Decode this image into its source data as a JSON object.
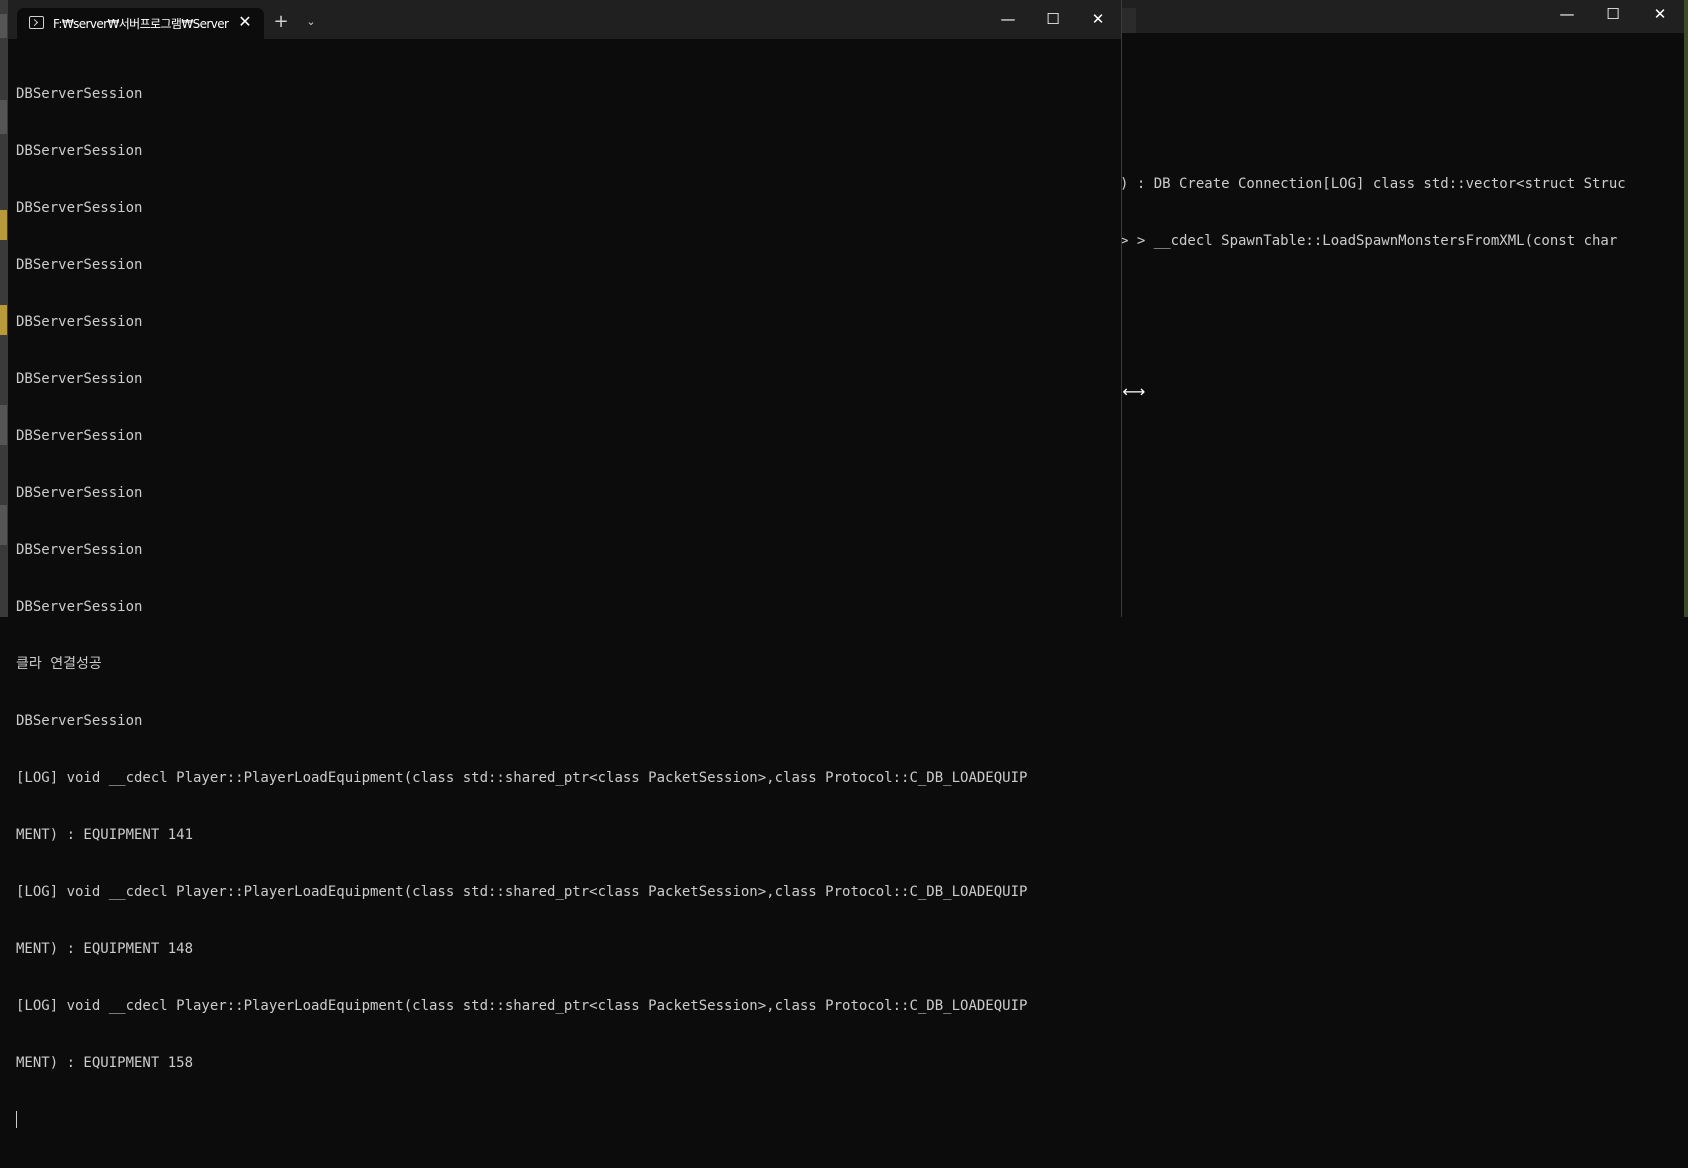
{
  "foreground_window": {
    "tab_title": "F:₩server₩서버프로그램₩Server",
    "tab_close": "✕",
    "new_tab": "+",
    "dropdown": "⌄",
    "controls": {
      "minimize": "—",
      "maximize": "☐",
      "close": "✕"
    },
    "lines": [
      "DBServerSession",
      "DBServerSession",
      "DBServerSession",
      "DBServerSession",
      "DBServerSession",
      "DBServerSession",
      "DBServerSession",
      "DBServerSession",
      "DBServerSession",
      "DBServerSession",
      "클라 연결성공",
      "DBServerSession",
      "[LOG] void __cdecl Player::PlayerLoadEquipment(class std::shared_ptr<class PacketSession>,class Protocol::C_DB_LOADEQUIP",
      "MENT) : EQUIPMENT 141",
      "[LOG] void __cdecl Player::PlayerLoadEquipment(class std::shared_ptr<class PacketSession>,class Protocol::C_DB_LOADEQUIP",
      "MENT) : EQUIPMENT 148",
      "[LOG] void __cdecl Player::PlayerLoadEquipment(class std::shared_ptr<class PacketSession>,class Protocol::C_DB_LOADEQUIP",
      "MENT) : EQUIPMENT 158"
    ]
  },
  "background_window": {
    "controls": {
      "minimize": "—",
      "maximize": "☐",
      "close": "✕"
    },
    "lines": [
      ") : DB Create Connection[LOG] class std::vector<struct Struc",
      "> > __cdecl SpawnTable::LoadSpawnMonstersFromXML(const char"
    ]
  },
  "mouse_cursor": "⟷"
}
